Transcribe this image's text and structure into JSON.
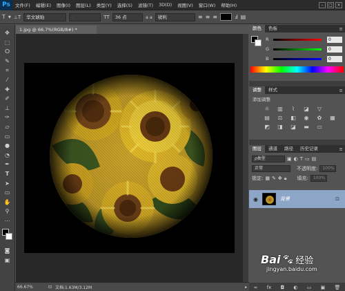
{
  "app": {
    "logo": "Ps"
  },
  "menubar": {
    "items": [
      "文件(F)",
      "编辑(E)",
      "图像(I)",
      "图层(L)",
      "类型(Y)",
      "选择(S)",
      "滤镜(T)",
      "3D(D)",
      "视图(V)",
      "窗口(W)",
      "帮助(H)"
    ]
  },
  "options": {
    "tool_icon": "T",
    "font_family": "华文琥珀",
    "font_style": "-",
    "size_label": "36 点",
    "aa_label": "a a",
    "aa_mode": "锐利"
  },
  "document": {
    "tab_title": "1.jpg @ 66.7%(RGB/8#) *"
  },
  "status": {
    "zoom": "66.67%",
    "doc_info": "文档:1.63M/3.12M"
  },
  "color_panel": {
    "tabs": [
      "颜色",
      "色板"
    ],
    "r_label": "R",
    "g_label": "G",
    "b_label": "B",
    "r_value": "0",
    "g_value": "0",
    "b_value": "0"
  },
  "adjust_panel": {
    "tabs": [
      "调整",
      "样式"
    ],
    "add_label": "添加调整"
  },
  "layers_panel": {
    "tabs": [
      "图层",
      "通道",
      "路径",
      "历史记录"
    ],
    "kind": "ρ类型",
    "blend": "正常",
    "opacity_label": "不透明度:",
    "opacity_value": "100%",
    "lock_label": "锁定:",
    "fill_label": "填充:",
    "fill_value": "100%",
    "layer_name": "背景"
  },
  "watermark": {
    "brand": "Bai",
    "brand2": "经验",
    "url": "jingyan.baidu.com"
  },
  "colors": {
    "accent": "#8da5c6",
    "ui_dark": "#2b2b2b",
    "ui_mid": "#535353"
  }
}
